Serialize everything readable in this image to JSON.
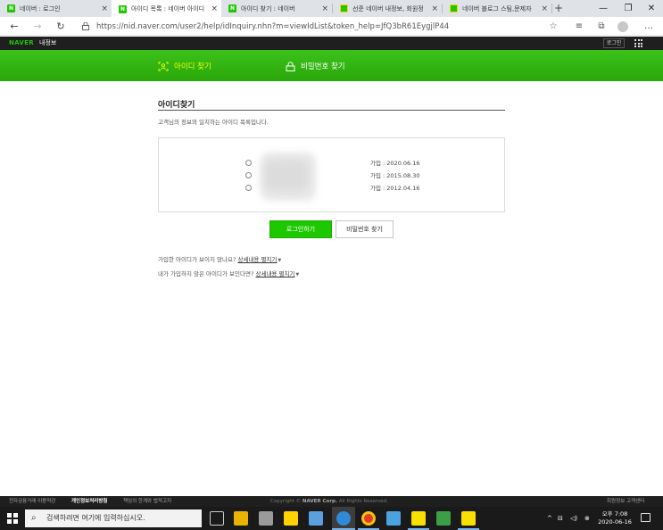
{
  "browser": {
    "tabs": [
      {
        "title": "네이버 : 로그인",
        "favicon": "naver-n"
      },
      {
        "title": "아이디 목록 : 네이버 아이디",
        "favicon": "naver-n"
      },
      {
        "title": "아이디 찾기 : 네이버",
        "favicon": "naver-n"
      },
      {
        "title": "선준 네이버 내정보, 회원정",
        "favicon": "naver-green"
      },
      {
        "title": "네이버 블로그 스팀,문제자",
        "favicon": "naver-green"
      }
    ],
    "active_tab_index": 1,
    "new_tab_symbol": "+",
    "close_symbol": "×",
    "url": "https://nid.naver.com/user2/help/idInquiry.nhn?m=viewIdList&token_help=JfQ3bR61EygjlP44",
    "window_controls": [
      "—",
      "❐",
      "✕"
    ],
    "nav_icons": [
      "←",
      "→",
      "↻"
    ],
    "toolbar_icons": [
      "☆",
      "≡",
      "⧉",
      "…"
    ]
  },
  "naver_bar": {
    "logo": "NAVER",
    "service": "내정보",
    "login": "로그인"
  },
  "green_nav": {
    "tabs": [
      {
        "label": "아이디 찾기",
        "selected": true
      },
      {
        "label": "비밀번호 찾기",
        "selected": false
      }
    ],
    "selected_color": "#f6ff00"
  },
  "content": {
    "title": "아이디찾기",
    "description": "고객님의 정보와 일치하는 아이디 목록입니다.",
    "accounts": [
      {
        "joined": "가입 : 2020.06.16"
      },
      {
        "joined": "가입 : 2015.08.30"
      },
      {
        "joined": "가입 : 2012.04.16"
      }
    ],
    "buttons": {
      "login": "로그인하기",
      "find_password": "비밀번호 찾기"
    },
    "help_notes": [
      {
        "text": "가입한 아이디가 보이지 않나요?",
        "link": "상세내용 펼치기"
      },
      {
        "text": "내가 가입하지 않은 아이디가 보인다면?",
        "link": "상세내용 펼치기"
      }
    ],
    "brand_green": "#1ec800"
  },
  "footer": {
    "links": [
      {
        "label": "전자금융거래 이용약관",
        "bold": false
      },
      {
        "label": "개인정보처리방침",
        "bold": true
      },
      {
        "label": "책임의 한계와 법적고지",
        "bold": false
      }
    ],
    "copyright_prefix": "Copyright ©",
    "copyright_brand": "NAVER Corp.",
    "copyright_suffix": "All Rights Reserved.",
    "right_link": "회원정보 고객센터"
  },
  "taskbar": {
    "search_placeholder": "검색하려면 여기에 입력하십시오.",
    "time": "오후 7:08",
    "date": "2020-06-16",
    "tray_icons": [
      "^",
      "⊟",
      "◁)",
      "⊗"
    ]
  }
}
